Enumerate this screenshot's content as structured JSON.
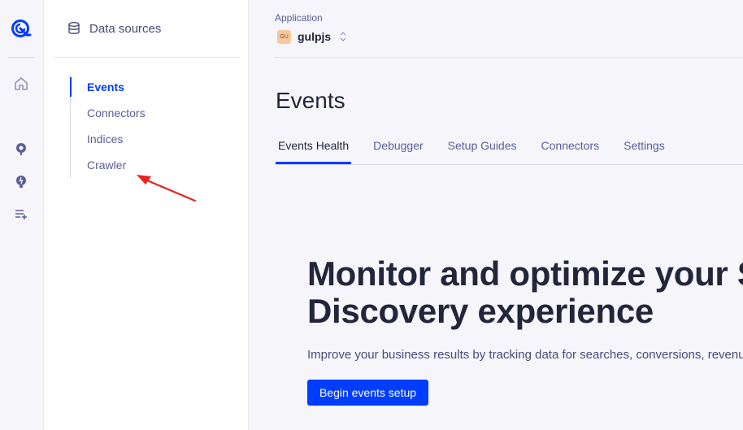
{
  "sidebar": {
    "title": "Data sources",
    "items": [
      {
        "label": "Events",
        "active": true
      },
      {
        "label": "Connectors",
        "active": false
      },
      {
        "label": "Indices",
        "active": false
      },
      {
        "label": "Crawler",
        "active": false
      }
    ]
  },
  "application": {
    "label": "Application",
    "badge": "GU",
    "name": "gulpjs"
  },
  "page": {
    "title": "Events",
    "tabs": [
      {
        "label": "Events Health",
        "active": true
      },
      {
        "label": "Debugger",
        "active": false
      },
      {
        "label": "Setup Guides",
        "active": false
      },
      {
        "label": "Connectors",
        "active": false
      },
      {
        "label": "Settings",
        "active": false
      }
    ]
  },
  "hero": {
    "heading_line1": "Monitor and optimize your Site Search &",
    "heading_line2": "Discovery experience",
    "description": "Improve your business results by tracking data for searches, conversions, revenue, and more.",
    "cta_label": "Begin events setup"
  },
  "colors": {
    "accent": "#003dff",
    "annotation_arrow": "#e8241c",
    "badge_bg": "#f7c79e"
  },
  "icons": {
    "logo": "algolia-logo-icon",
    "rail": [
      "home-icon",
      "search-pin-icon",
      "lightbulb-icon",
      "playlist-add-icon"
    ],
    "panel": "database-icon"
  }
}
